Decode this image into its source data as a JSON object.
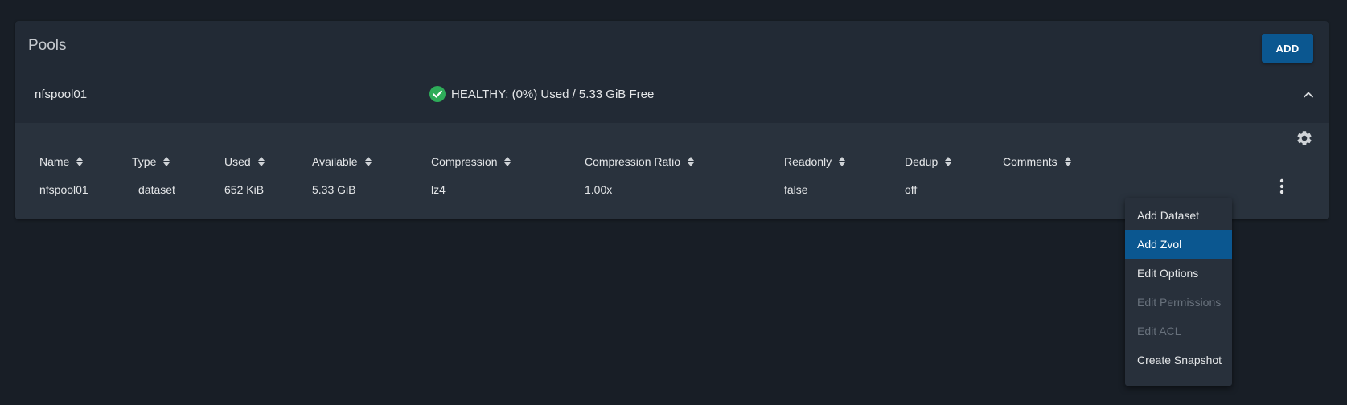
{
  "card": {
    "title": "Pools",
    "add_label": "ADD"
  },
  "pool": {
    "name": "nfspool01",
    "status_text": "HEALTHY: (0%) Used / 5.33 GiB Free",
    "status_color": "#2eac59"
  },
  "table": {
    "columns": [
      "Name",
      "Type",
      "Used",
      "Available",
      "Compression",
      "Compression Ratio",
      "Readonly",
      "Dedup",
      "Comments"
    ],
    "rows": [
      [
        "nfspool01",
        "dataset",
        "652 KiB",
        "5.33 GiB",
        "lz4",
        "1.00x",
        "false",
        "off",
        ""
      ]
    ]
  },
  "menu": {
    "items": [
      {
        "label": "Add Dataset",
        "state": "normal"
      },
      {
        "label": "Add Zvol",
        "state": "highlighted"
      },
      {
        "label": "Edit Options",
        "state": "normal"
      },
      {
        "label": "Edit Permissions",
        "state": "disabled"
      },
      {
        "label": "Edit ACL",
        "state": "disabled"
      },
      {
        "label": "Create Snapshot",
        "state": "normal"
      }
    ]
  },
  "colors": {
    "background": "#181e26",
    "card": "#222a35",
    "panel": "#29323d",
    "accent": "#0b5790"
  }
}
